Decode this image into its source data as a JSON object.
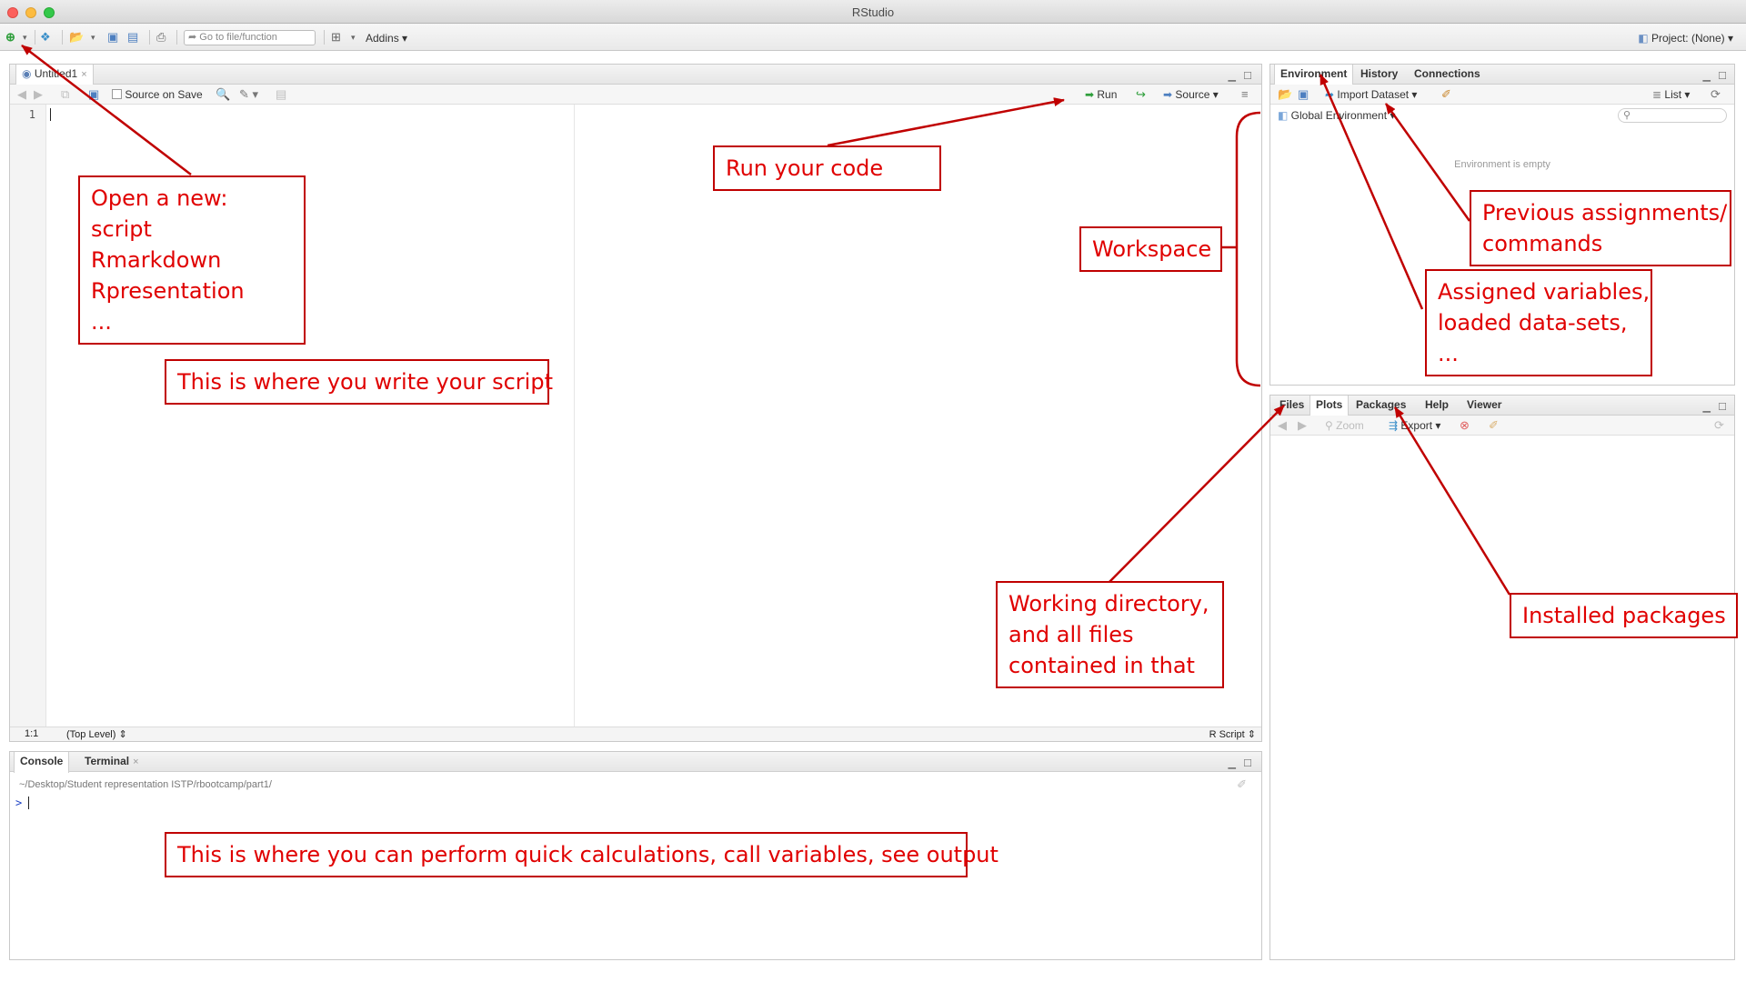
{
  "window": {
    "title": "RStudio"
  },
  "toolbar": {
    "goto_placeholder": "Go to file/function",
    "addins_label": "Addins",
    "project_label": "Project: (None)"
  },
  "source": {
    "tab_label": "Untitled1",
    "source_on_save_label": "Source on Save",
    "run_label": "Run",
    "source_label": "Source",
    "line_number": "1",
    "cursor_position": "1:1",
    "scope_label": "(Top Level)",
    "file_type_label": "R Script"
  },
  "console": {
    "tabs": [
      "Console",
      "Terminal"
    ],
    "path": "~/Desktop/Student representation ISTP/rbootcamp/part1/",
    "prompt": ">"
  },
  "environment": {
    "tabs": [
      "Environment",
      "History",
      "Connections"
    ],
    "import_label": "Import Dataset",
    "list_label": "List",
    "scope_label": "Global Environment",
    "empty_label": "Environment is empty"
  },
  "files": {
    "tabs": [
      "Files",
      "Plots",
      "Packages",
      "Help",
      "Viewer"
    ],
    "zoom_label": "Zoom",
    "export_label": "Export"
  },
  "annotations": {
    "open_new": [
      "Open a new:",
      "script",
      "Rmarkdown",
      "Rpresentation",
      "..."
    ],
    "write_script": "This is where you write your script",
    "run_code": "Run your code",
    "workspace": "Workspace",
    "previous": [
      "Previous assignments/",
      "commands"
    ],
    "assigned": [
      "Assigned variables,",
      "loaded data-sets,",
      "..."
    ],
    "working_dir": [
      "Working directory,",
      "and all files",
      "contained in that"
    ],
    "installed": "Installed packages",
    "console_note": "This is where you can perform quick calculations, call variables, see output"
  },
  "colors": {
    "annotation_red": "#e00000",
    "prompt_blue": "#1a3fc4"
  }
}
